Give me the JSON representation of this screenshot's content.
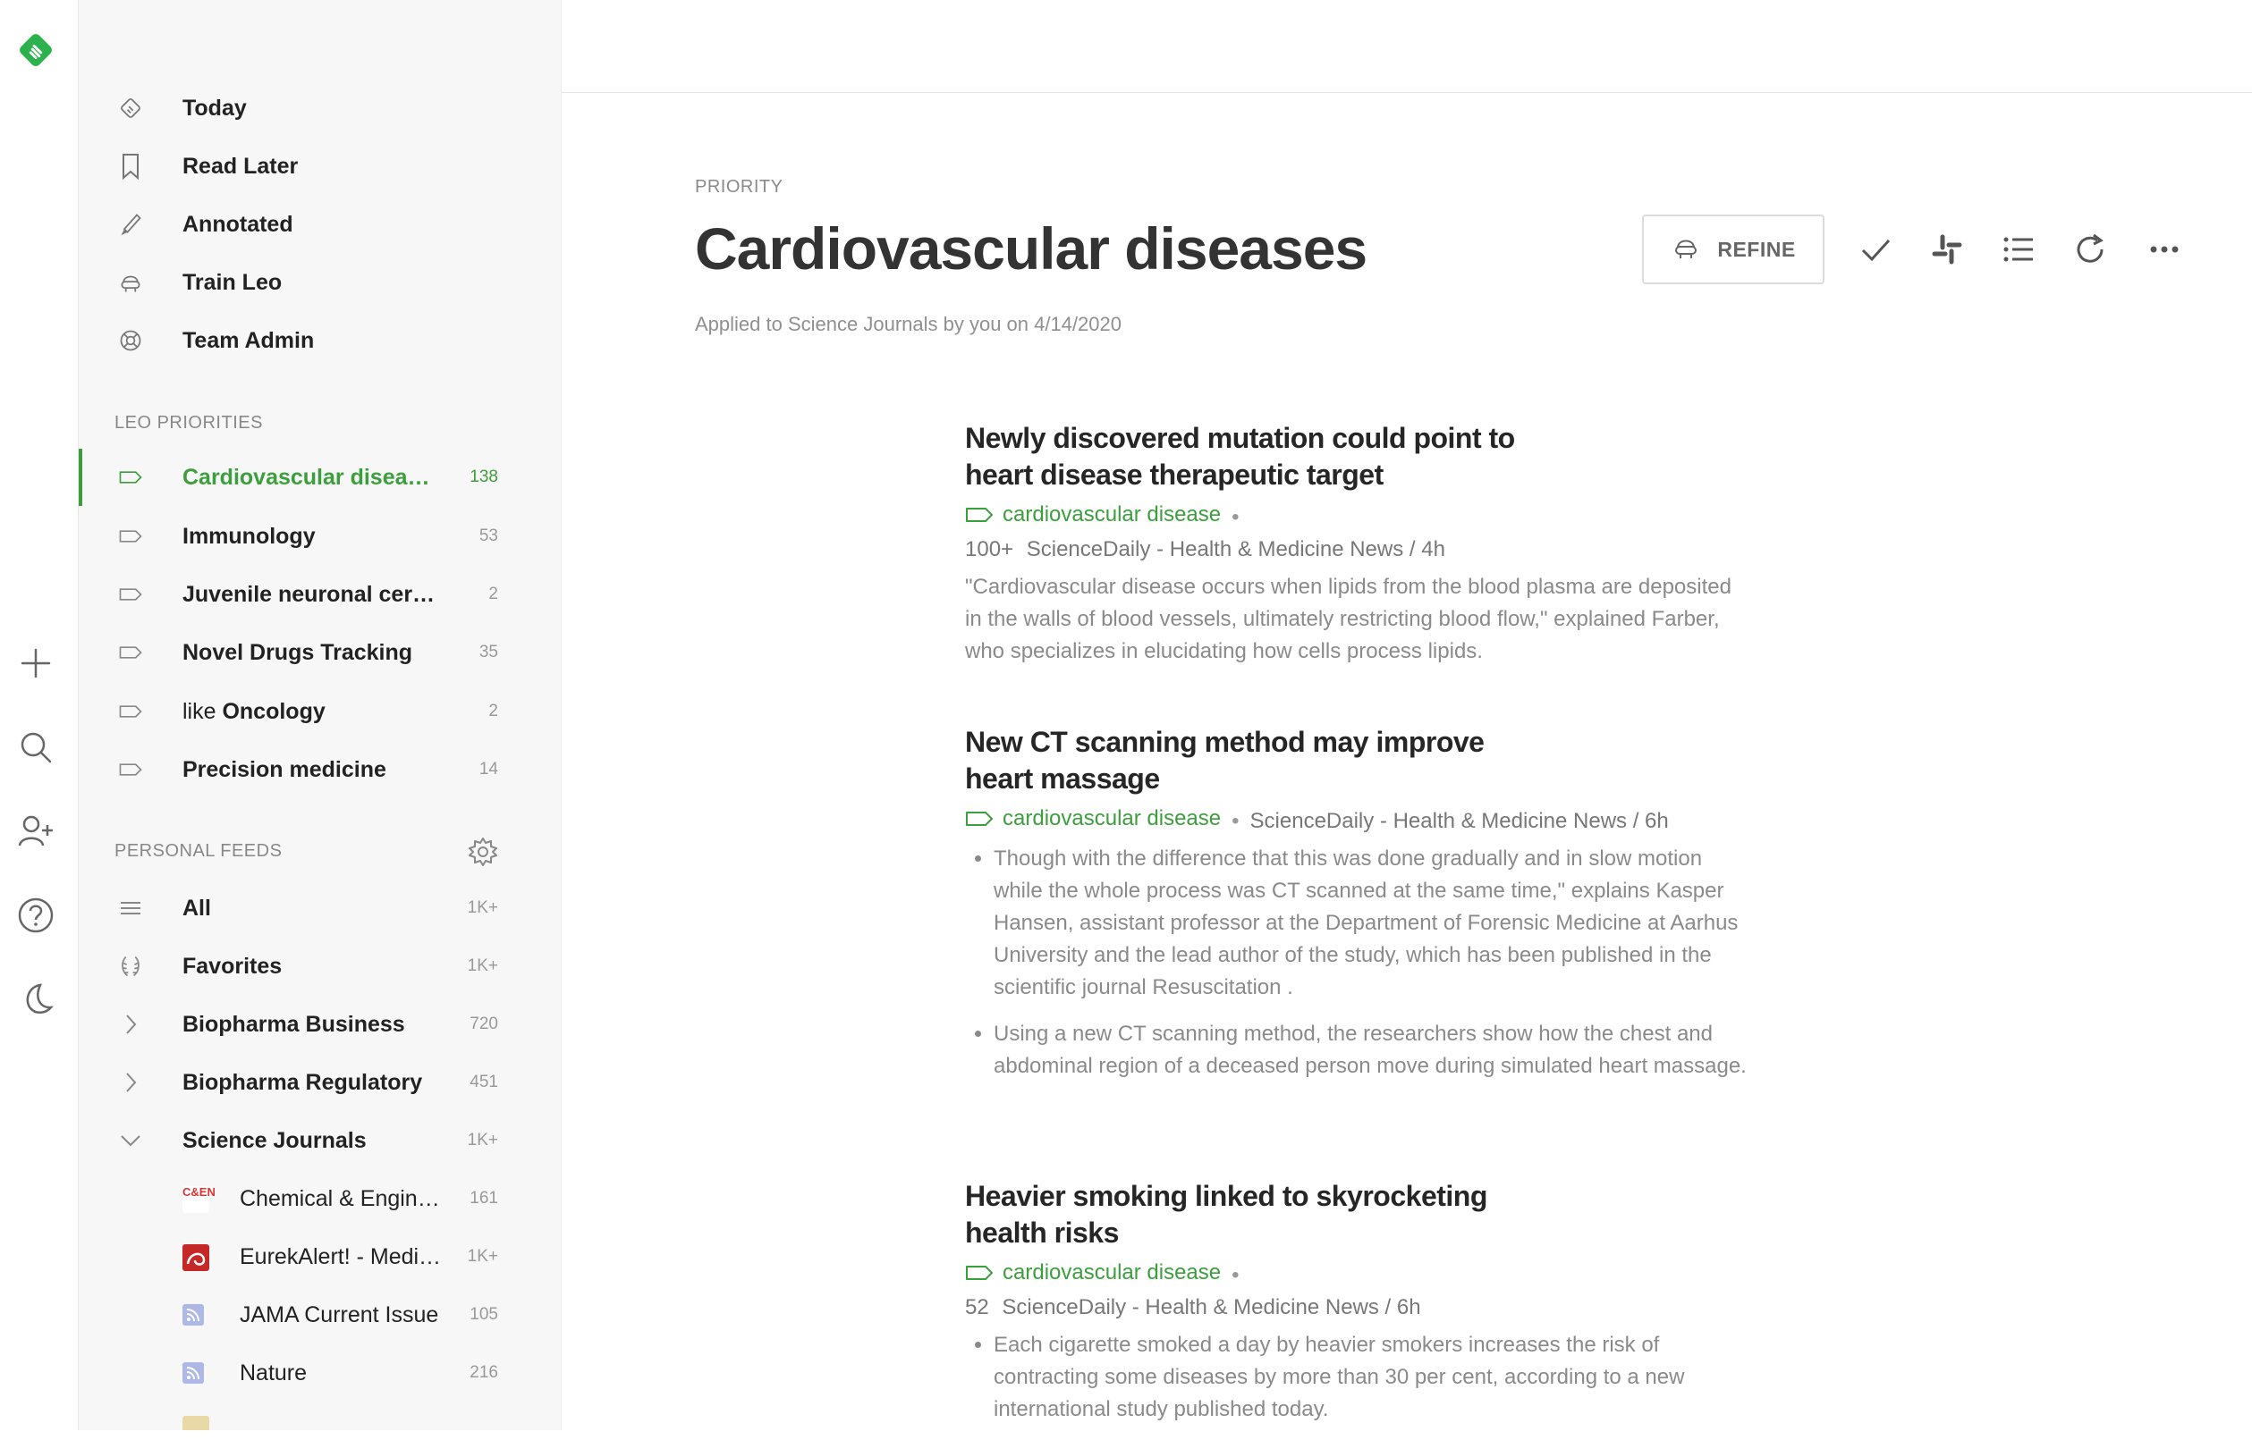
{
  "sidebar": {
    "nav": [
      {
        "label": "Today"
      },
      {
        "label": "Read Later"
      },
      {
        "label": "Annotated"
      },
      {
        "label": "Train Leo"
      },
      {
        "label": "Team Admin"
      }
    ],
    "priorities_title": "LEO PRIORITIES",
    "priorities": [
      {
        "label": "Cardiovascular disea…",
        "count": "138"
      },
      {
        "label": "Immunology",
        "count": "53"
      },
      {
        "label": "Juvenile neuronal cer…",
        "count": "2"
      },
      {
        "label": "Novel Drugs Tracking",
        "count": "35"
      },
      {
        "prefix": "like ",
        "label": "Oncology",
        "count": "2"
      },
      {
        "label": "Precision medicine",
        "count": "14"
      }
    ],
    "personal_title": "PERSONAL FEEDS",
    "feeds": [
      {
        "label": "All",
        "count": "1K+"
      },
      {
        "label": "Favorites",
        "count": "1K+"
      },
      {
        "label": "Biopharma Business",
        "count": "720"
      },
      {
        "label": "Biopharma Regulatory",
        "count": "451"
      },
      {
        "label": "Science Journals",
        "count": "1K+"
      }
    ],
    "sources": [
      {
        "label": "Chemical & Engin…",
        "count": "161",
        "icon_text": "C&EN"
      },
      {
        "label": "EurekAlert! - Medi…",
        "count": "1K+"
      },
      {
        "label": "JAMA Current Issue",
        "count": "105"
      },
      {
        "label": "Nature",
        "count": "216"
      }
    ]
  },
  "main": {
    "kicker": "PRIORITY",
    "title": "Cardiovascular diseases",
    "subtitle": "Applied to Science Journals by you on 4/14/2020",
    "refine_label": "REFINE"
  },
  "articles": [
    {
      "title": "Newly discovered mutation could point to heart disease therapeutic target",
      "tag": "cardiovascular disease",
      "popularity": "100+",
      "source": "ScienceDaily - Health & Medicine News / 4h",
      "summary": "\"Cardiovascular disease occurs when lipids from the blood plasma are deposited in the walls of blood vessels, ultimately restricting blood flow,\" explained Farber, who specializes in elucidating how cells process lipids."
    },
    {
      "title": "New CT scanning method may improve heart massage",
      "tag": "cardiovascular disease",
      "source": "ScienceDaily - Health & Medicine News / 6h",
      "bullets": [
        "Though with the difference that this was done gradually and in slow motion while the whole process was CT scanned at the same time,\" explains Kasper Hansen, assistant professor at the Department of Forensic Medicine at Aarhus University and the lead author of the study, which has been published in the scientific journal Resuscitation .",
        "Using a new CT scanning method, the researchers show how the chest and abdominal region of a deceased person move during simulated heart massage."
      ]
    },
    {
      "title": "Heavier smoking linked to skyrocketing health risks",
      "tag": "cardiovascular disease",
      "popularity": "52",
      "source": "ScienceDaily - Health & Medicine News / 6h",
      "bullets": [
        "Each cigarette smoked a day by heavier smokers increases the risk of contracting some diseases by more than 30 per cent, according to a new international study published today."
      ]
    }
  ],
  "colors": {
    "accent": "#3c9e3c",
    "sidebar_bg": "#f7f7f7"
  }
}
